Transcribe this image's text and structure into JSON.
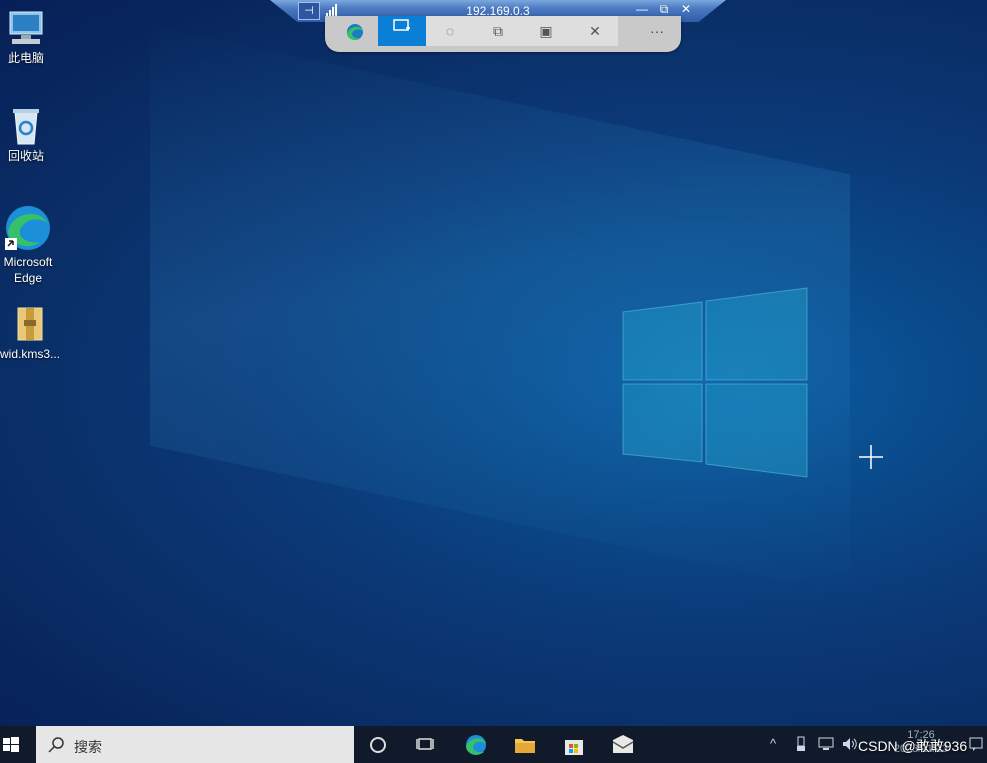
{
  "remote_bar": {
    "title": "192.169.0.3",
    "pin_label": "⊣",
    "minimize": "—",
    "restore": "⧉",
    "close": "✕"
  },
  "snip_toolbar": {
    "tools": [
      "rectangle-snip",
      "freeform-snip",
      "window-snip",
      "fullscreen-snip"
    ],
    "close": "✕",
    "more": "···"
  },
  "desktop": {
    "icons": [
      {
        "name": "this-pc",
        "label": "此电脑"
      },
      {
        "name": "recycle-bin",
        "label": "回收站"
      },
      {
        "name": "edge",
        "label": "Microsoft Edge"
      },
      {
        "name": "file",
        "label": "wid.kms3..."
      }
    ]
  },
  "taskbar": {
    "search_placeholder": "搜索",
    "clock_time": "17:26",
    "clock_date": "2023/11/23"
  },
  "watermark": "CSDN @敢敢936"
}
